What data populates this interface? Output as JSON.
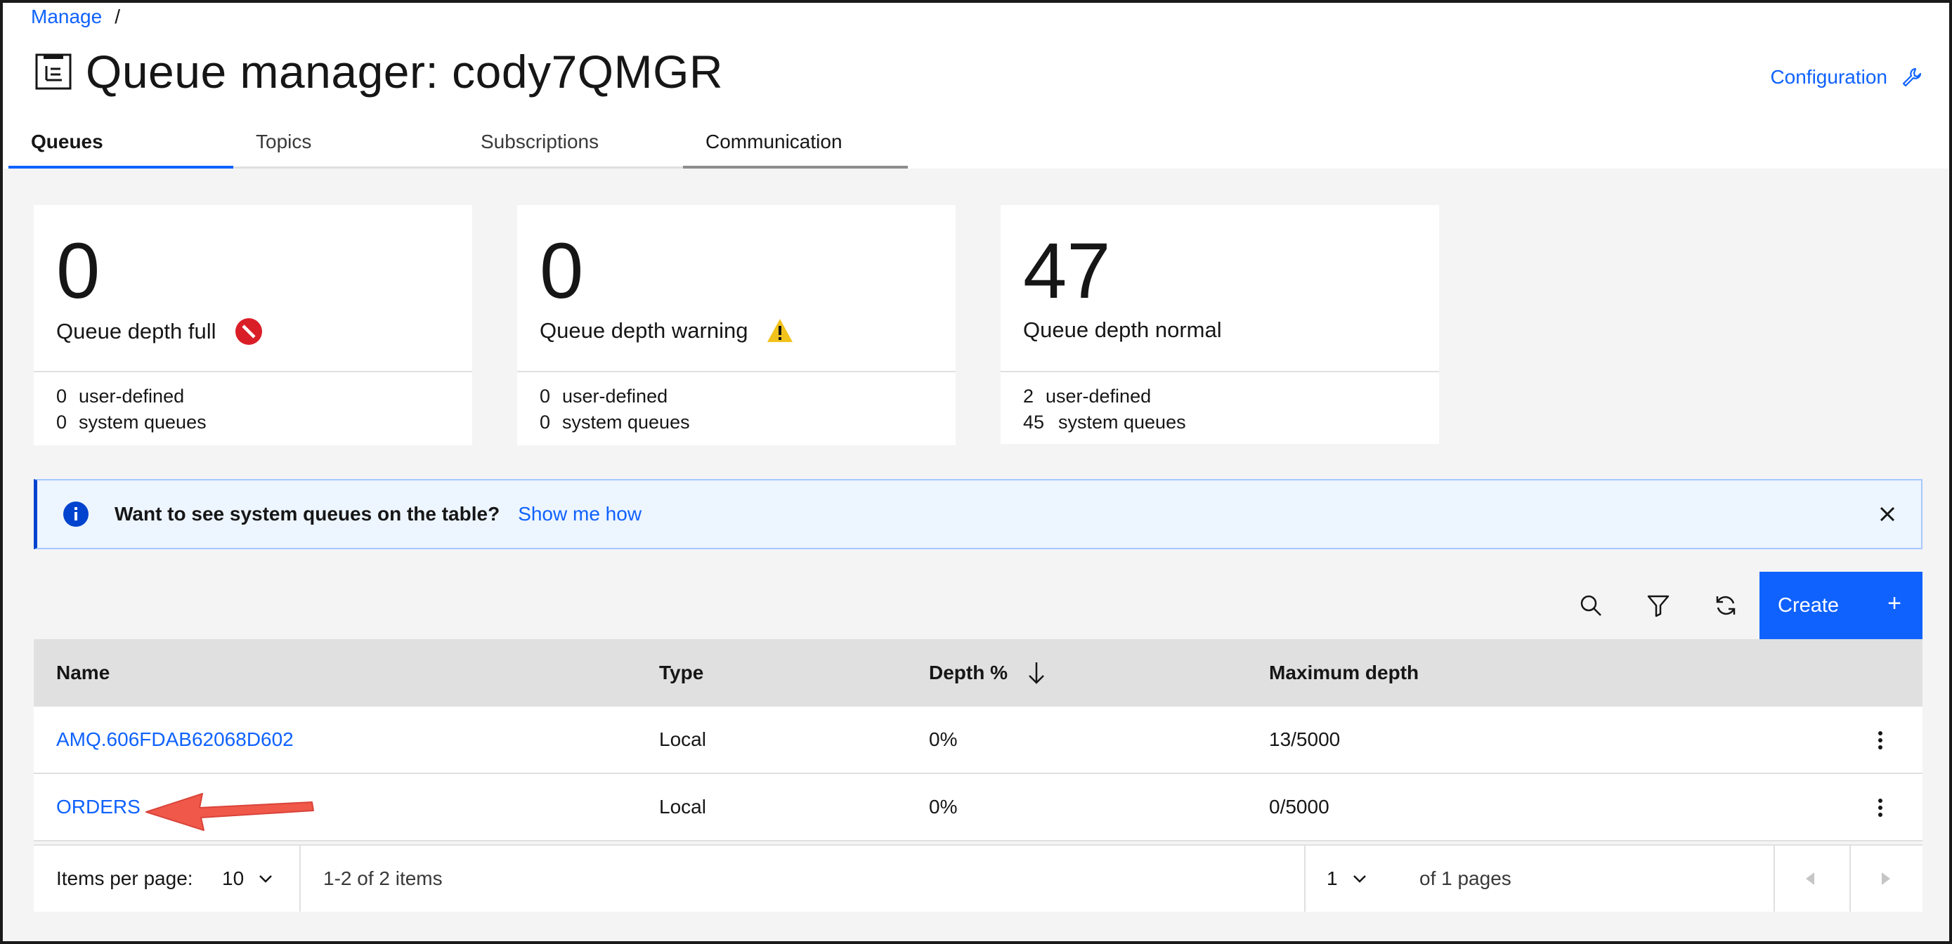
{
  "breadcrumb": {
    "manage": "Manage",
    "separator": "/"
  },
  "header": {
    "title": "Queue manager: cody7QMGR",
    "configuration_label": "Configuration",
    "title_icon": "queue-manager-icon",
    "configuration_icon": "wrench-icon"
  },
  "tabs": [
    {
      "label": "Queues",
      "active": true
    },
    {
      "label": "Topics",
      "active": false
    },
    {
      "label": "Subscriptions",
      "active": false
    },
    {
      "label": "Communication",
      "active": false
    }
  ],
  "cards": [
    {
      "count": "0",
      "label": "Queue depth full",
      "status_icon": "error-icon",
      "user_defined": "0",
      "user_defined_label": "user-defined",
      "system": "0",
      "system_label": "system queues"
    },
    {
      "count": "0",
      "label": "Queue depth warning",
      "status_icon": "warning-icon",
      "user_defined": "0",
      "user_defined_label": "user-defined",
      "system": "0",
      "system_label": "system queues"
    },
    {
      "count": "47",
      "label": "Queue depth normal",
      "status_icon": "",
      "user_defined": "2",
      "user_defined_label": "user-defined",
      "system": "45",
      "system_label": "system queues"
    }
  ],
  "banner": {
    "message": "Want to see system queues on the table?",
    "link": "Show me how",
    "icon": "info-icon"
  },
  "toolbar": {
    "create_label": "Create",
    "create_plus": "+",
    "icons": [
      "search-icon",
      "filter-icon",
      "refresh-icon"
    ]
  },
  "table": {
    "headers": {
      "name": "Name",
      "type": "Type",
      "depth": "Depth %",
      "max": "Maximum depth"
    },
    "sort_icon": "arrow-down-icon",
    "rows": [
      {
        "name": "AMQ.606FDAB62068D602",
        "type": "Local",
        "depth": "0%",
        "max": "13/5000"
      },
      {
        "name": "ORDERS",
        "type": "Local",
        "depth": "0%",
        "max": "0/5000"
      }
    ]
  },
  "pagination": {
    "items_per_page_label": "Items per page:",
    "items_per_page": "10",
    "range": "1-2 of 2 items",
    "page": "1",
    "of_pages": "of 1 pages"
  },
  "colors": {
    "accent": "#0f62fe",
    "error": "#da1e28",
    "warning": "#f1c21b",
    "annotation_arrow": "#f0584a"
  }
}
